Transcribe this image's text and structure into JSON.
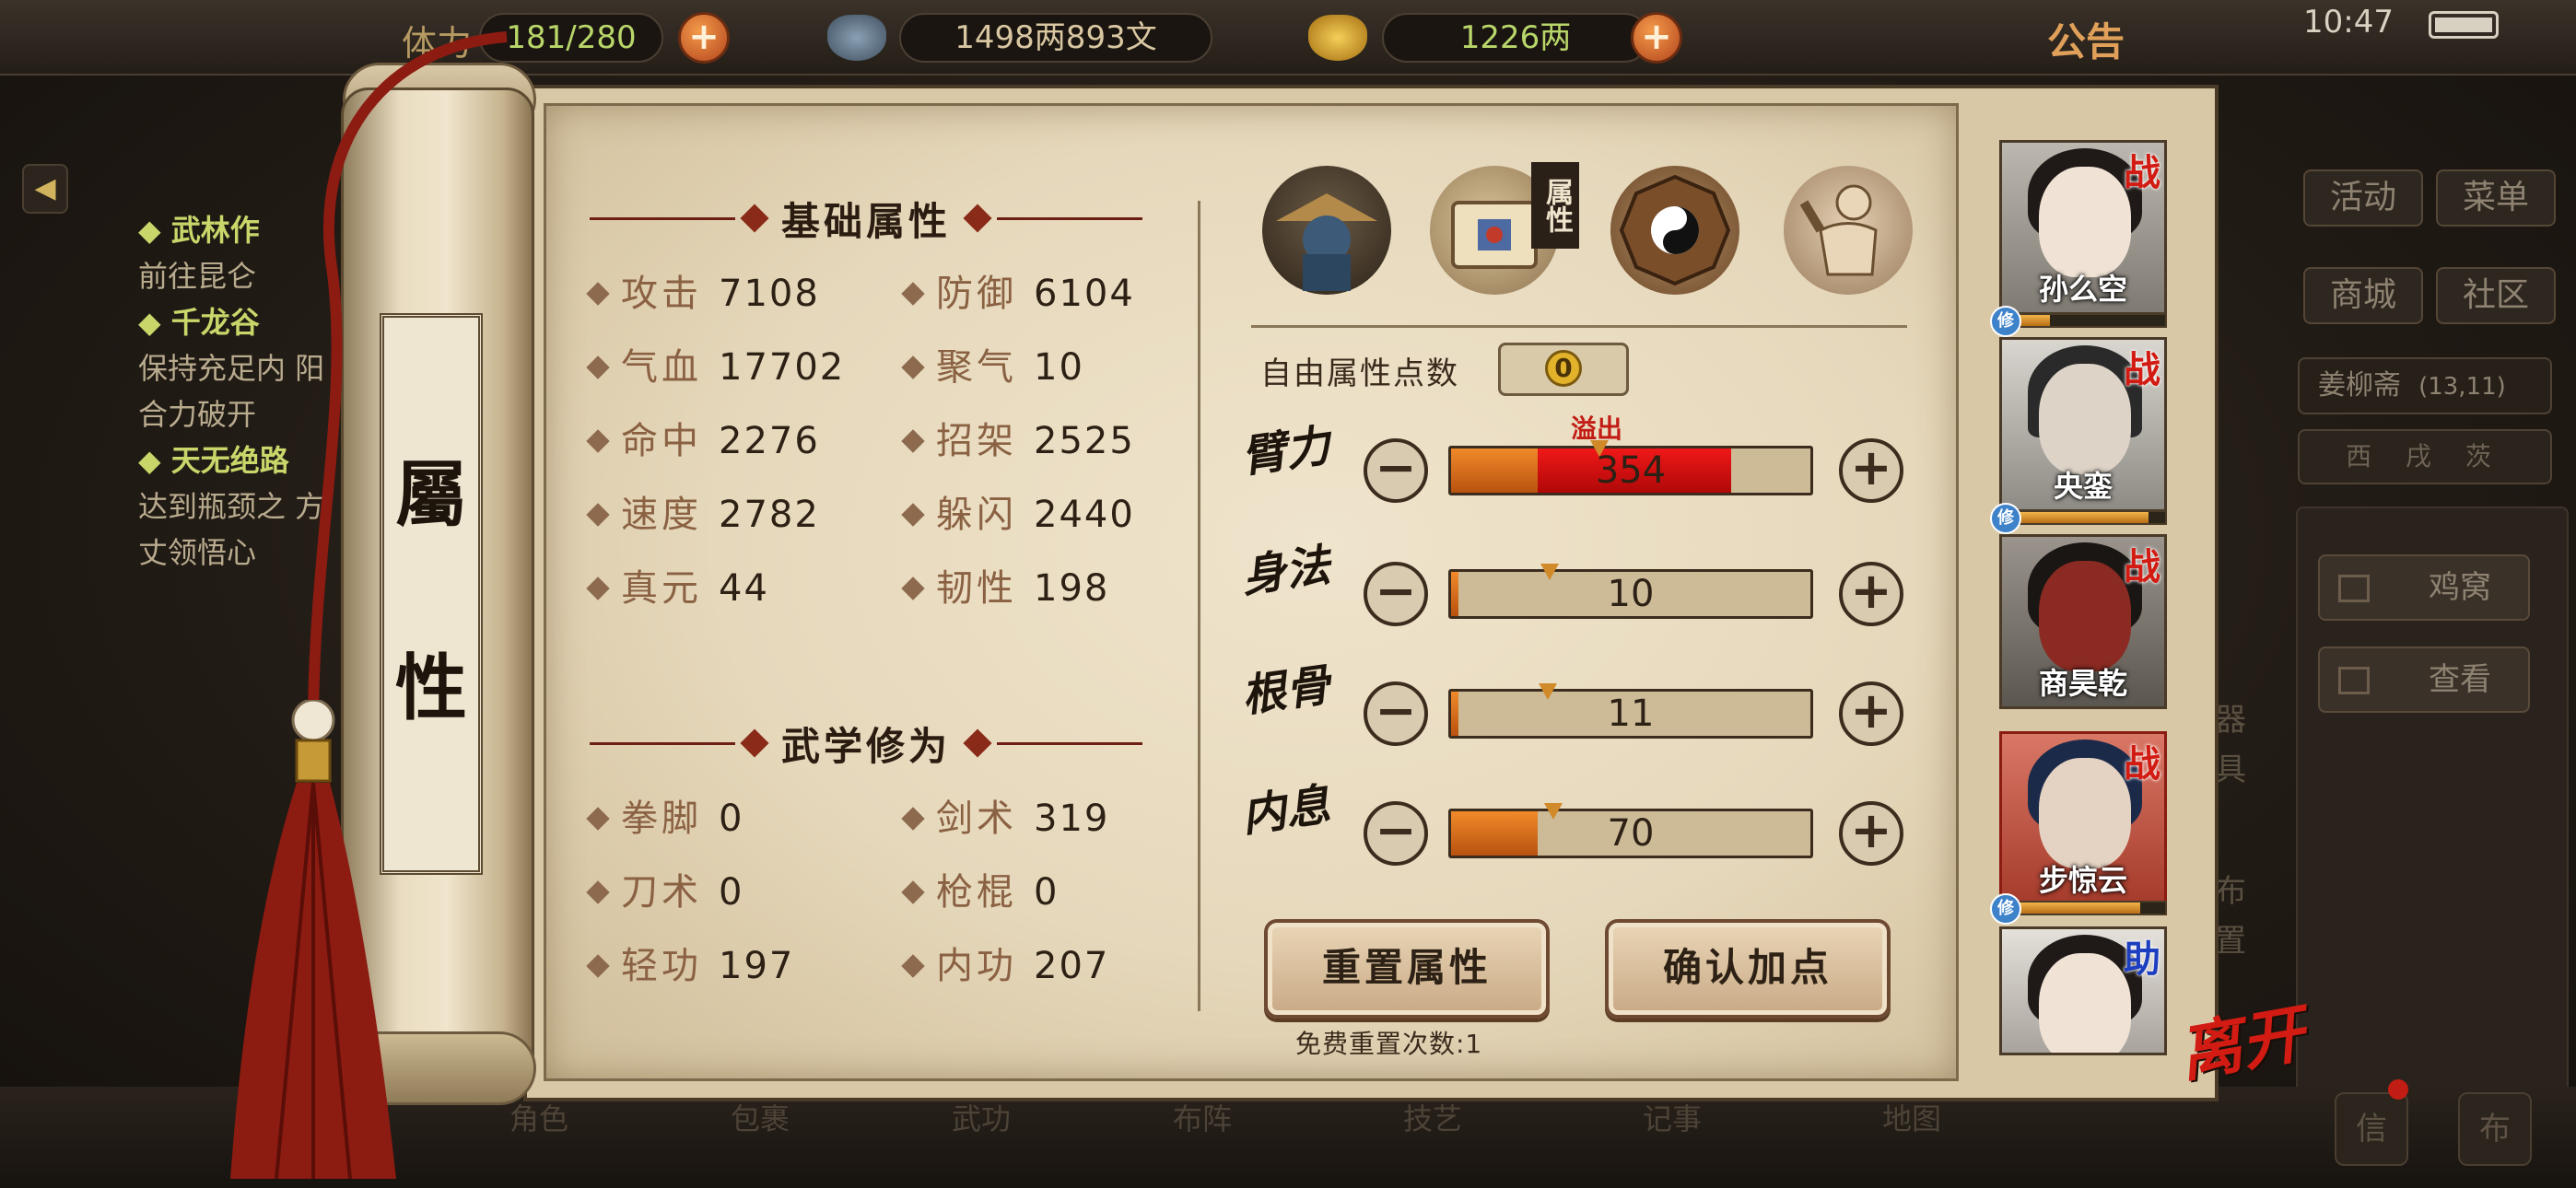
{
  "hud": {
    "stamina_label": "体力",
    "stamina": "181/280",
    "silver": "1498两893文",
    "gold": "1226两",
    "notice": "公告",
    "clock": "10:47"
  },
  "left_quests": [
    {
      "title": "武林作",
      "desc": "前往昆仑"
    },
    {
      "title": "千龙谷",
      "desc": "保持充足内 阳合力破开"
    },
    {
      "title": "天无绝路",
      "desc": "达到瓶颈之 方丈领悟心"
    }
  ],
  "right_menu": {
    "activity": "活动",
    "menu": "菜单",
    "shop": "商城",
    "community": "社区",
    "location": "姜柳斋",
    "coords": "(13,11)",
    "compass": "西 戌 茨",
    "nest": "鸡窝",
    "view": "查看"
  },
  "bottom_nav": [
    "角色",
    "包裹",
    "武功",
    "布阵",
    "技艺",
    "记事",
    "地图"
  ],
  "bottom_corner": [
    "信",
    "布"
  ],
  "side_fragments": [
    "器",
    "具",
    "布",
    "置"
  ],
  "scroll": {
    "title_top": "屬",
    "title_bottom": "性"
  },
  "basic": {
    "header": "基础属性",
    "stats": [
      {
        "name": "攻击",
        "value": "7108"
      },
      {
        "name": "防御",
        "value": "6104"
      },
      {
        "name": "气血",
        "value": "17702"
      },
      {
        "name": "聚气",
        "value": "10"
      },
      {
        "name": "命中",
        "value": "2276"
      },
      {
        "name": "招架",
        "value": "2525"
      },
      {
        "name": "速度",
        "value": "2782"
      },
      {
        "name": "躲闪",
        "value": "2440"
      },
      {
        "name": "真元",
        "value": "44"
      },
      {
        "name": "韧性",
        "value": "198"
      }
    ]
  },
  "martial": {
    "header": "武学修为",
    "stats": [
      {
        "name": "拳脚",
        "value": "0"
      },
      {
        "name": "剑术",
        "value": "319"
      },
      {
        "name": "刀术",
        "value": "0"
      },
      {
        "name": "枪棍",
        "value": "0"
      },
      {
        "name": "轻功",
        "value": "197"
      },
      {
        "name": "内功",
        "value": "207"
      }
    ]
  },
  "tabs": {
    "active_label": "属性"
  },
  "free_points": {
    "label": "自由属性点数",
    "value": "0"
  },
  "attributes": {
    "overflow_label": "溢出",
    "items": [
      {
        "name": "臂力",
        "value": "354",
        "fill": 0.24,
        "overflow": 0.78
      },
      {
        "name": "身法",
        "value": "10",
        "fill": 0.02
      },
      {
        "name": "根骨",
        "value": "11",
        "fill": 0.02
      },
      {
        "name": "内息",
        "value": "70",
        "fill": 0.24
      }
    ]
  },
  "buttons": {
    "reset": "重置属性",
    "confirm": "确认加点",
    "reset_count": "免费重置次数:1"
  },
  "roster": [
    {
      "name": "孙么空",
      "tag": "战",
      "xp": 0.3
    },
    {
      "name": "央銮",
      "tag": "战",
      "xp": 0.9
    },
    {
      "name": "商昊乾",
      "tag": "战",
      "xp": null
    },
    {
      "name": "步惊云",
      "tag": "战",
      "xp": 0.85
    },
    {
      "name": "",
      "tag": "助",
      "xp": null
    }
  ],
  "xiu_label": "修",
  "leave": "离开",
  "colors": {
    "accent_red": "#c21d14",
    "bar_orange": "#f08a2a",
    "paper": "#e6d8bb"
  }
}
